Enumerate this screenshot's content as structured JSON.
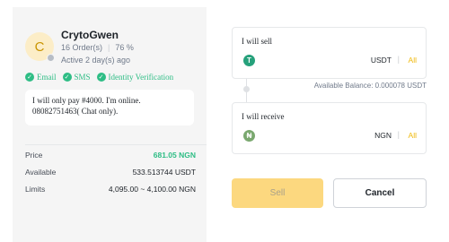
{
  "merchant": {
    "avatar_letter": "C",
    "name": "CrytoGwen",
    "orders": "16 Order(s)",
    "completion": "76 %",
    "active": "Active 2 day(s) ago",
    "verifications": [
      "Email",
      "SMS",
      "Identity Verification"
    ],
    "remark": "I will only pay #4000. I'm online. 08082751463( Chat only)."
  },
  "details": [
    {
      "label": "Price",
      "value": "681.05 NGN"
    },
    {
      "label": "Available",
      "value": "533.513744 USDT"
    },
    {
      "label": "Limits",
      "value": "4,095.00 ~ 4,100.00 NGN"
    }
  ],
  "sell_box": {
    "label": "I will sell",
    "coin_icon": "T",
    "currency": "USDT",
    "all_label": "All"
  },
  "available_balance": "Available Balance: 0.000078 USDT",
  "receive_box": {
    "label": "I will receive",
    "coin_icon": "₦",
    "currency": "NGN",
    "all_label": "All"
  },
  "buttons": {
    "sell": "Sell",
    "cancel": "Cancel"
  },
  "colors": {
    "green": "#2ebd85",
    "accent": "#f0b90b",
    "sell_button": "#fcd87f"
  }
}
